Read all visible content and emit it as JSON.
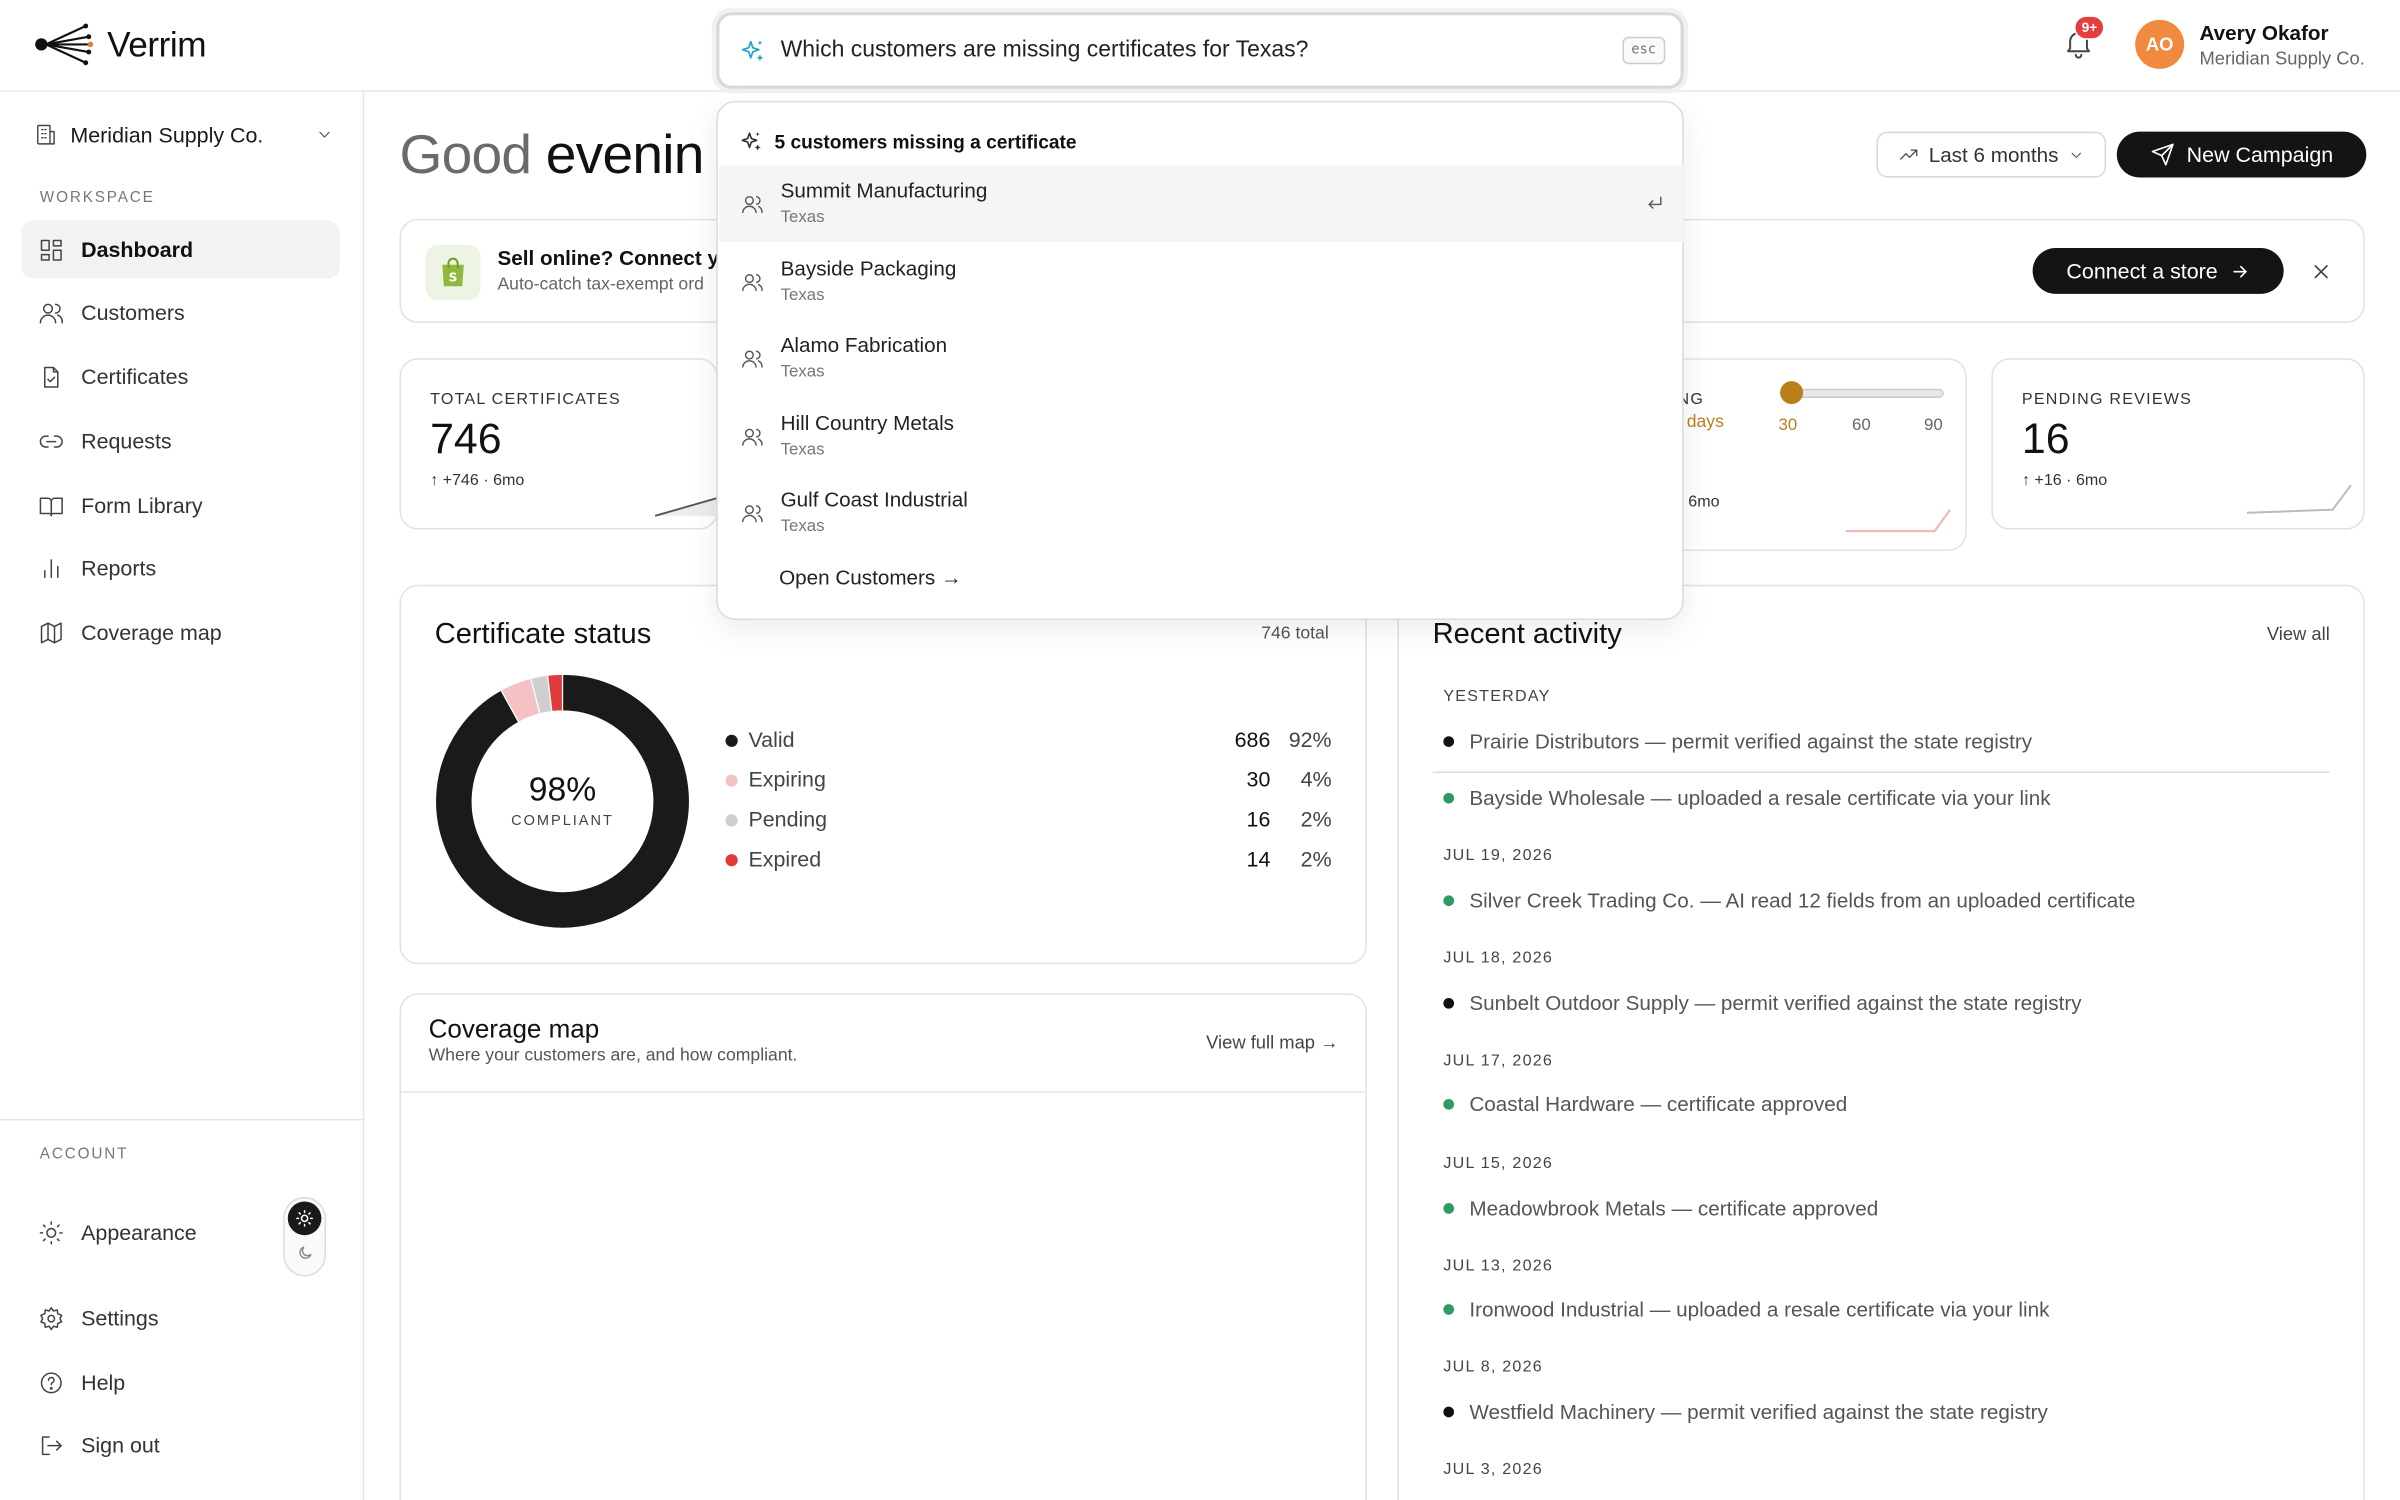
{
  "app": {
    "name": "Verrim"
  },
  "search": {
    "query": "Which customers are missing certificates for Texas?",
    "esc_key": "esc"
  },
  "header": {
    "notifications_badge": "9+",
    "user_initials": "AO",
    "user_name": "Avery Okafor",
    "user_org": "Meridian Supply Co."
  },
  "sidebar": {
    "org_name": "Meridian Supply Co.",
    "workspace_label": "WORKSPACE",
    "items": [
      {
        "label": "Dashboard",
        "icon": "dashboard-icon"
      },
      {
        "label": "Customers",
        "icon": "users-icon"
      },
      {
        "label": "Certificates",
        "icon": "file-check-icon"
      },
      {
        "label": "Requests",
        "icon": "link-icon"
      },
      {
        "label": "Form Library",
        "icon": "book-icon"
      },
      {
        "label": "Reports",
        "icon": "bar-chart-icon"
      },
      {
        "label": "Coverage map",
        "icon": "map-icon"
      }
    ],
    "account_label": "ACCOUNT",
    "account_items": [
      {
        "label": "Appearance",
        "icon": "sun-icon"
      },
      {
        "label": "Settings",
        "icon": "gear-icon"
      },
      {
        "label": "Help",
        "icon": "help-icon"
      },
      {
        "label": "Sign out",
        "icon": "sign-out-icon"
      }
    ]
  },
  "main": {
    "greeting_part1": "Good",
    "greeting_part2": "evenin",
    "range_label": "Last 6 months",
    "new_campaign_label": "New Campaign",
    "banner": {
      "title": "Sell online? Connect yo",
      "subtitle": "Auto-catch tax-exempt ord",
      "connect_label": "Connect a store"
    },
    "stats": [
      {
        "label": "TOTAL CERTIFICATES",
        "value": "746",
        "delta": "+746 · 6mo"
      },
      {
        "label": "NG",
        "sub_label": "days",
        "delta": "6mo",
        "slider_options": [
          "30",
          "60",
          "90"
        ],
        "slider_value": "30"
      },
      {
        "label": "PENDING REVIEWS",
        "value": "16",
        "delta": "+16 · 6mo"
      }
    ],
    "certificate_status": {
      "title": "Certificate status",
      "total_label": "746 total",
      "center_value": "98%",
      "center_label": "COMPLIANT",
      "rows": [
        {
          "name": "Valid",
          "count": "686",
          "pct": "92%",
          "color": "#1a1a1a",
          "value": 686
        },
        {
          "name": "Expiring",
          "count": "30",
          "pct": "4%",
          "color": "#f4c2c2",
          "value": 30
        },
        {
          "name": "Pending",
          "count": "16",
          "pct": "2%",
          "color": "#cfcfcf",
          "value": 16
        },
        {
          "name": "Expired",
          "count": "14",
          "pct": "2%",
          "color": "#e03a3a",
          "value": 14
        }
      ]
    },
    "coverage_map": {
      "title": "Coverage map",
      "subtitle": "Where your customers are, and how compliant.",
      "link": "View full map →"
    },
    "recent_activity": {
      "title": "Recent activity",
      "view_all": "View all",
      "groups": [
        {
          "date": "YESTERDAY",
          "items": [
            {
              "text": "Prairie Distributors — permit verified against the state registry",
              "color": "#111111"
            },
            {
              "text": "Bayside Wholesale — uploaded a resale certificate via your link",
              "color": "#2e9b63"
            }
          ]
        },
        {
          "date": "JUL 19, 2026",
          "items": [
            {
              "text": "Silver Creek Trading Co. — AI read 12 fields from an uploaded certificate",
              "color": "#2e9b63"
            }
          ]
        },
        {
          "date": "JUL 18, 2026",
          "items": [
            {
              "text": "Sunbelt Outdoor Supply — permit verified against the state registry",
              "color": "#111111"
            }
          ]
        },
        {
          "date": "JUL 17, 2026",
          "items": [
            {
              "text": "Coastal Hardware — certificate approved",
              "color": "#2e9b63"
            }
          ]
        },
        {
          "date": "JUL 15, 2026",
          "items": [
            {
              "text": "Meadowbrook Metals — certificate approved",
              "color": "#2e9b63"
            }
          ]
        },
        {
          "date": "JUL 13, 2026",
          "items": [
            {
              "text": "Ironwood Industrial — uploaded a resale certificate via your link",
              "color": "#2e9b63"
            }
          ]
        },
        {
          "date": "JUL 8, 2026",
          "items": [
            {
              "text": "Westfield Machinery — permit verified against the state registry",
              "color": "#111111"
            }
          ]
        },
        {
          "date": "JUL 3, 2026",
          "items": []
        }
      ]
    }
  },
  "dropdown": {
    "header": "5 customers missing a certificate",
    "results": [
      {
        "name": "Summit Manufacturing",
        "state": "Texas"
      },
      {
        "name": "Bayside Packaging",
        "state": "Texas"
      },
      {
        "name": "Alamo Fabrication",
        "state": "Texas"
      },
      {
        "name": "Hill Country Metals",
        "state": "Texas"
      },
      {
        "name": "Gulf Coast Industrial",
        "state": "Texas"
      }
    ],
    "open_link": "Open Customers →"
  }
}
